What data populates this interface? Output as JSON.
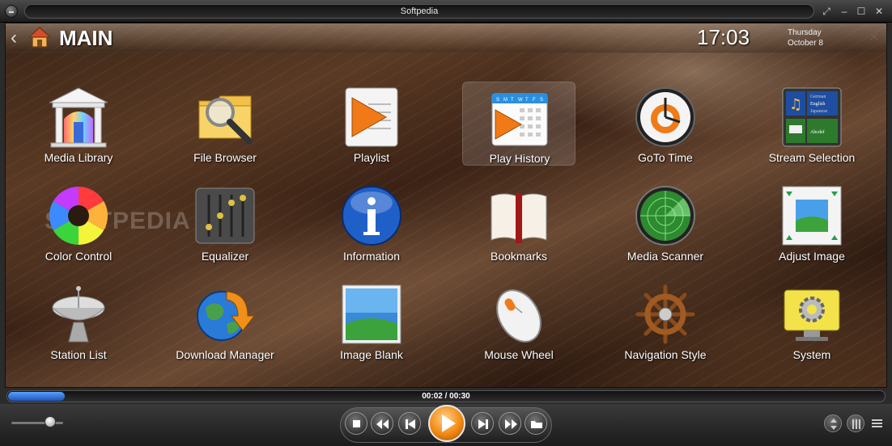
{
  "window": {
    "title": "Softpedia"
  },
  "header": {
    "title": "MAIN",
    "time": "17:03",
    "day": "Thursday",
    "date": "October 8"
  },
  "watermark": "SOFTPEDIA",
  "tiles": [
    {
      "label": "Media Library"
    },
    {
      "label": "File Browser"
    },
    {
      "label": "Playlist"
    },
    {
      "label": "Play History"
    },
    {
      "label": "GoTo Time"
    },
    {
      "label": "Stream Selection"
    },
    {
      "label": "Color Control"
    },
    {
      "label": "Equalizer"
    },
    {
      "label": "Information"
    },
    {
      "label": "Bookmarks"
    },
    {
      "label": "Media Scanner"
    },
    {
      "label": "Adjust Image"
    },
    {
      "label": "Station List"
    },
    {
      "label": "Download Manager"
    },
    {
      "label": "Image Blank"
    },
    {
      "label": "Mouse Wheel"
    },
    {
      "label": "Navigation Style"
    },
    {
      "label": "System"
    }
  ],
  "calendar_icon": {
    "weekdays": [
      "S",
      "M",
      "T",
      "W",
      "T",
      "F",
      "S"
    ]
  },
  "language_icon": {
    "items": [
      "German",
      "English",
      "Japanese",
      "Abcdef"
    ]
  },
  "playback": {
    "time": "00:02 / 00:30",
    "progress": 0.065,
    "volume": 0.75
  },
  "colors": {
    "accent_orange": "#f28a12",
    "progress_blue": "#2f6fd8"
  }
}
